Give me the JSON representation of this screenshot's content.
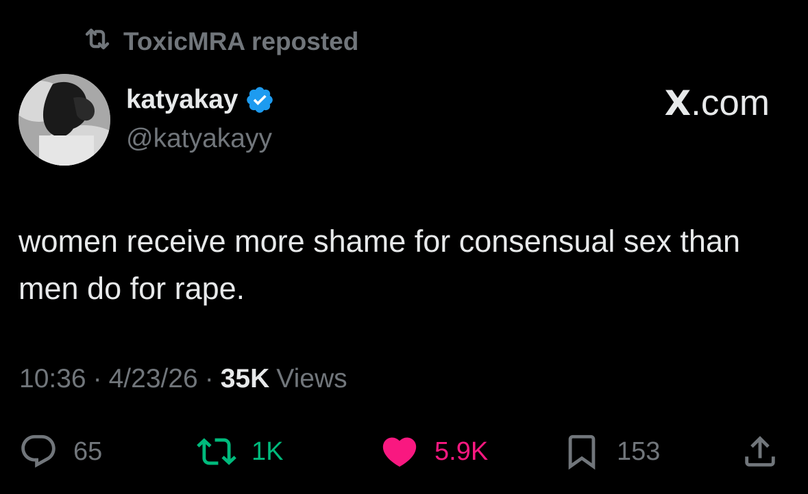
{
  "repost": {
    "icon": "repost-icon",
    "text": "ToxicMRA reposted"
  },
  "author": {
    "display_name": "katyakay",
    "handle": "@katyakayy",
    "verified": true,
    "verified_color": "#1d9bf0"
  },
  "brand": {
    "x": "X",
    "suffix": ".com"
  },
  "tweet": {
    "text": "women receive more shame for consensual sex than men do for rape."
  },
  "meta": {
    "time": "10:36",
    "sep1": "·",
    "date": "4/23/26",
    "sep2": "·",
    "views_count": "35K",
    "views_label": "Views"
  },
  "actions": {
    "replies": {
      "icon": "reply-icon",
      "count": "65"
    },
    "reposts": {
      "icon": "repost-icon",
      "count": "1K",
      "color": "#00ba7c"
    },
    "likes": {
      "icon": "heart-icon",
      "count": "5.9K",
      "color": "#f91880"
    },
    "bookmarks": {
      "icon": "bookmark-icon",
      "count": "153"
    },
    "share": {
      "icon": "share-icon"
    }
  },
  "colors": {
    "background": "#000000",
    "primary_text": "#e7e9ea",
    "secondary_text": "#71767b"
  }
}
